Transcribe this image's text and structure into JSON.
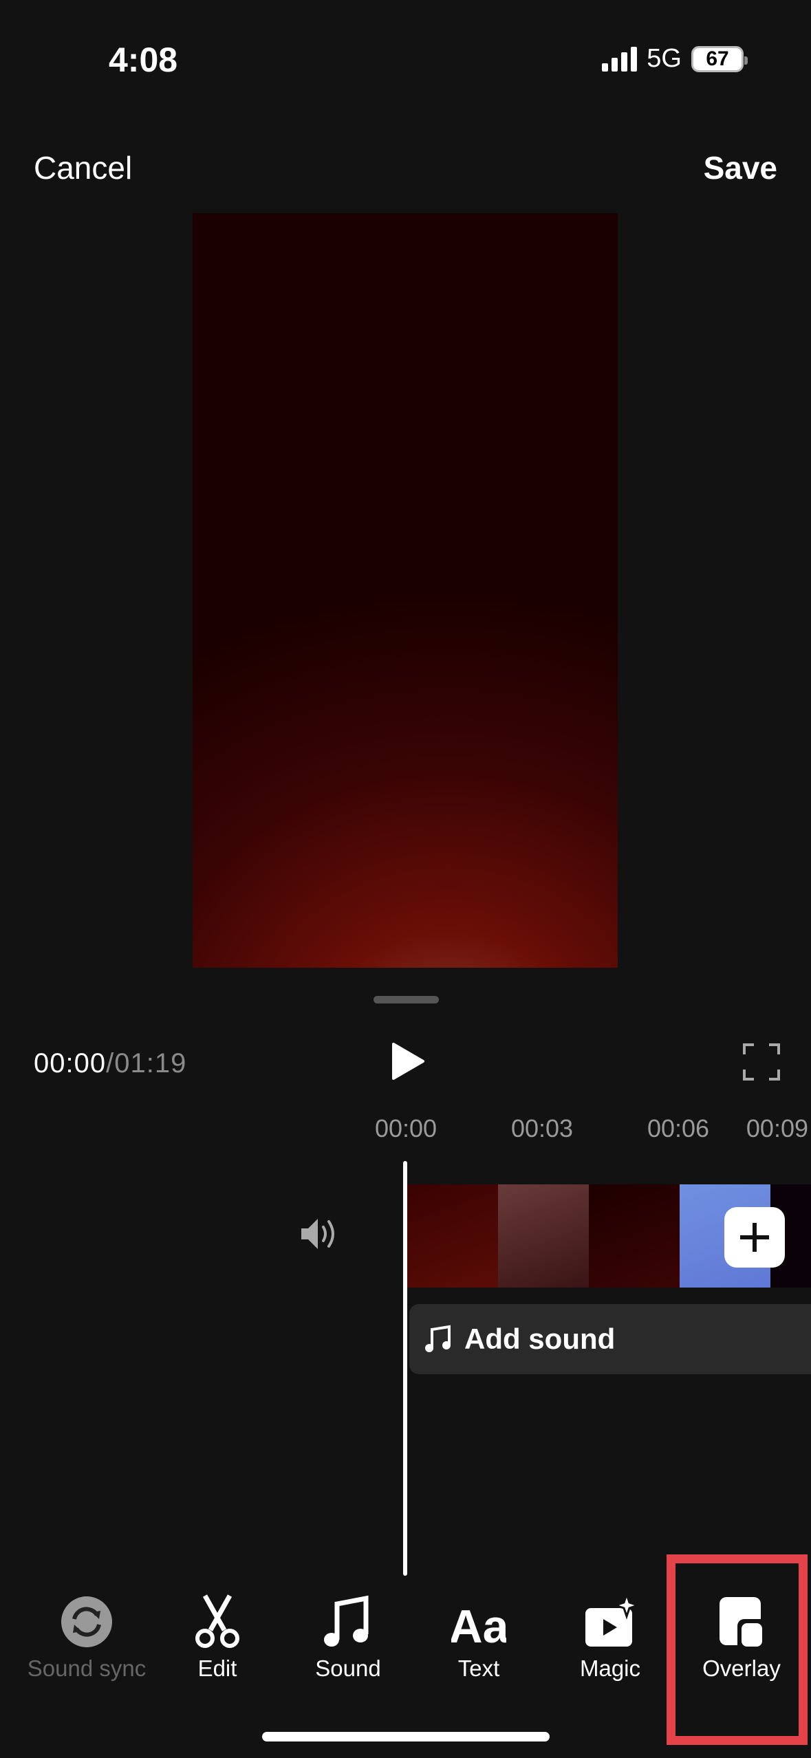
{
  "status_bar": {
    "time": "4:08",
    "network": "5G",
    "battery": "67"
  },
  "header": {
    "cancel_label": "Cancel",
    "save_label": "Save"
  },
  "player": {
    "current_time": "00:00",
    "separator": "/",
    "total_time": "01:19"
  },
  "timeline": {
    "ticks": [
      "00:00",
      "00:03",
      "00:06",
      "00:09"
    ],
    "frame_colors": [
      "#4a0808",
      "#5a2a2a",
      "#2a0202",
      "#6a82d8",
      "#0a0208"
    ],
    "add_sound_label": "Add sound"
  },
  "toolbar": {
    "items": [
      {
        "label": "Sound sync",
        "icon": "sound-sync-icon",
        "disabled": true
      },
      {
        "label": "Edit",
        "icon": "scissors-icon"
      },
      {
        "label": "Sound",
        "icon": "music-note-icon"
      },
      {
        "label": "Text",
        "icon": "text-aa-icon"
      },
      {
        "label": "Magic",
        "icon": "magic-icon"
      },
      {
        "label": "Overlay",
        "icon": "overlay-icon",
        "highlighted": true
      }
    ]
  },
  "colors": {
    "background": "#121212",
    "highlight": "#e5434a"
  }
}
